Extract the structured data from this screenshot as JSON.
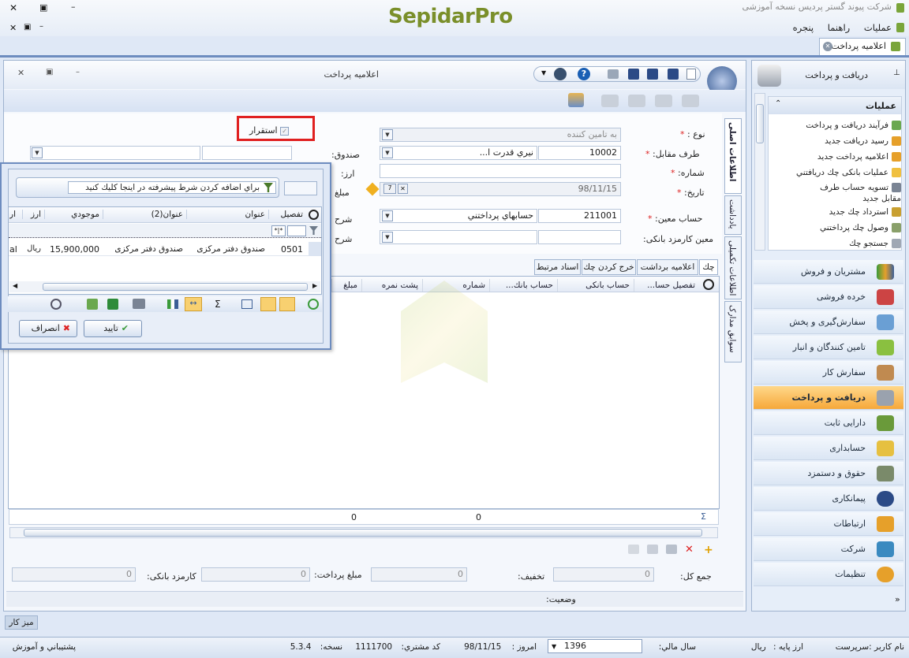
{
  "app": {
    "brand": "SepidarPro",
    "company": "شرکت پیوند گستر پردیس نسخه آموزشی",
    "menu": [
      "عملیات",
      "راهنما",
      "پنجره"
    ],
    "doc_tab": "اعلامیه پرداخت"
  },
  "form": {
    "title": "اعلامیه پرداخت",
    "type_label": "نوع :",
    "type_value": "به تامین کننده",
    "party_label": "طرف مقابل:",
    "party_code": "10002",
    "party_name": "نيري قدرت ا...",
    "number_label": "شماره:",
    "date_label": "تاریخ:",
    "date_value": "98/11/15",
    "account_label": "حساب معین:",
    "account_code": "211001",
    "account_name": "حسابهاي پرداختني",
    "bank_fee_label": "معین کارمزد بانکی:",
    "settle_label": "استقرار",
    "fund_label": "صندوق:",
    "currency_label": "ارز:",
    "amount_label": "مبلغ",
    "desc_label": "شرح",
    "desc2_label": "شرح"
  },
  "tabs": [
    "چك",
    "اعلامیه برداشت",
    "خرج کردن چك",
    "اسناد مرتبط"
  ],
  "grid_columns": [
    "تفصیل حسا...",
    "حساب بانکی",
    "حساب بانك...",
    "شماره",
    "پشت نمره",
    "مبلغ"
  ],
  "totals": [
    "0",
    "0"
  ],
  "footer": {
    "total_label": "جمع کل:",
    "total_value": "0",
    "discount_label": "تخفیف:",
    "discount_value": "0",
    "paid_label": "مبلغ پرداخت:",
    "paid_value": "0",
    "fee_label": "کارمزد بانکی:",
    "fee_value": "0",
    "status_label": "وضعیت:"
  },
  "vtabs": [
    "اطلاعات اصلی",
    "یادداشت",
    "اطلاعات تکمیلی",
    "سوابق مدارک"
  ],
  "popup": {
    "filter_hint": "براي اضافه كردن شرط پيشرفته در اينجا كليك كنيد",
    "columns": [
      "تفصیل",
      "عنوان",
      "عنوان(2)",
      "موجودي",
      "ارز",
      "ار"
    ],
    "row": {
      "code": "0501",
      "title": "صندوق دفتر مرکزی",
      "title2": "صندوق دفتر مرکزی",
      "balance": "15,900,000",
      "currency": "ريال",
      "extra": "al"
    },
    "ok": "تایید",
    "cancel": "انصراف"
  },
  "sidebar": {
    "header": "دریافت و پرداخت",
    "ops_title": "عملیات",
    "ops": [
      "فرآیند دریافت و پرداخت",
      "رسید دریافت جدید",
      "اعلامیه پرداخت جدید",
      "عملیات بانکی چك دریافتني",
      "تسويه حساب طرف مقابل جدید",
      "استرداد چك جدید",
      "وصول چك پرداختني",
      "جستجو چك"
    ],
    "nav": [
      "مشتریان و فروش",
      "خرده فروشی",
      "سفارش‌گیری و پخش",
      "تامین کنندگان و انبار",
      "سفارش کار",
      "دریافت و پرداخت",
      "دارایی ثابت",
      "حسابداری",
      "حقوق و دستمزد",
      "پیمانکاری",
      "ارتباطات",
      "شرکت",
      "تنظیمات"
    ],
    "active": "دریافت و پرداخت"
  },
  "desk_tab": "میز کار",
  "status_bar": {
    "user": "نام کاربر :سرپرست",
    "base_currency": "ارز پایه :",
    "base_currency_value": "ريال",
    "fiscal_year": "سال مالي:",
    "fiscal_year_value": "1396",
    "today": "امروز :",
    "today_value": "98/11/15",
    "customer_code": "کد مشتري:",
    "customer_code_value": "1111700",
    "version": "نسخه:",
    "version_value": "5.3.4",
    "support": "پشتيباني و آموزش"
  }
}
